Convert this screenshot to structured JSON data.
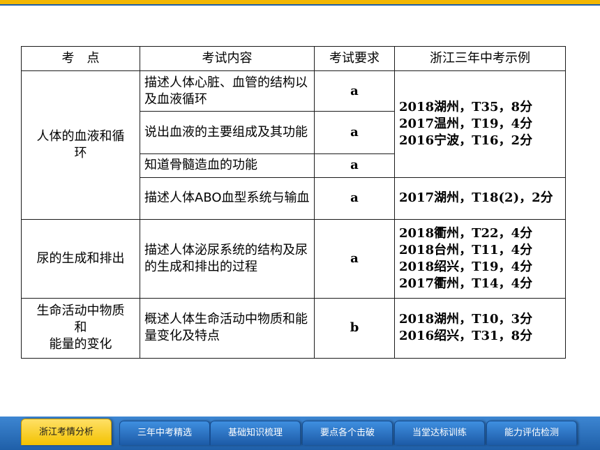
{
  "table": {
    "headers": [
      "考　点",
      "考试内容",
      "考试要求",
      "浙江三年中考示例"
    ],
    "groups": [
      {
        "topic_lines": [
          "人体的血液和循",
          "环"
        ],
        "rows": [
          {
            "content": "描述人体心脏、血管的结构以及血液循环",
            "req": "a"
          },
          {
            "content": "说出血液的主要组成及其功能",
            "req": "a"
          },
          {
            "content": "知道骨髓造血的功能",
            "req": "a"
          },
          {
            "content": "描述人体ABO血型系统与输血",
            "req": "a"
          }
        ],
        "examples_a": [
          "2018湖州，T35，8分",
          "2017温州，T19，4分",
          "2016宁波，T16，2分"
        ],
        "examples_b": [
          "2017湖州，T18(2)，2分"
        ]
      },
      {
        "topic_lines": [
          "尿的生成和排出"
        ],
        "rows": [
          {
            "content": "描述人体泌尿系统的结构及尿的生成和排出的过程",
            "req": "a"
          }
        ],
        "examples": [
          "2018衢州，T22，4分",
          "2018台州，T11，4分",
          "2018绍兴，T19，4分",
          "2017衢州，T14，4分"
        ]
      },
      {
        "topic_lines": [
          "生命活动中物质",
          "和",
          "能量的变化"
        ],
        "rows": [
          {
            "content": "概述人体生命活动中物质和能量变化及特点",
            "req": "b"
          }
        ],
        "examples": [
          "2018湖州，T10，3分",
          "2016绍兴，T31，8分"
        ]
      }
    ]
  },
  "nav": {
    "tabs": [
      "浙江考情分析",
      "三年中考精选",
      "基础知识梳理",
      "要点各个击破",
      "当堂达标训练",
      "能力评估检测"
    ],
    "active": 0
  },
  "colors": {
    "tab_blue": "#1f5fa8",
    "tab_active": "#f3c200",
    "top_bar": "#f2b705"
  }
}
